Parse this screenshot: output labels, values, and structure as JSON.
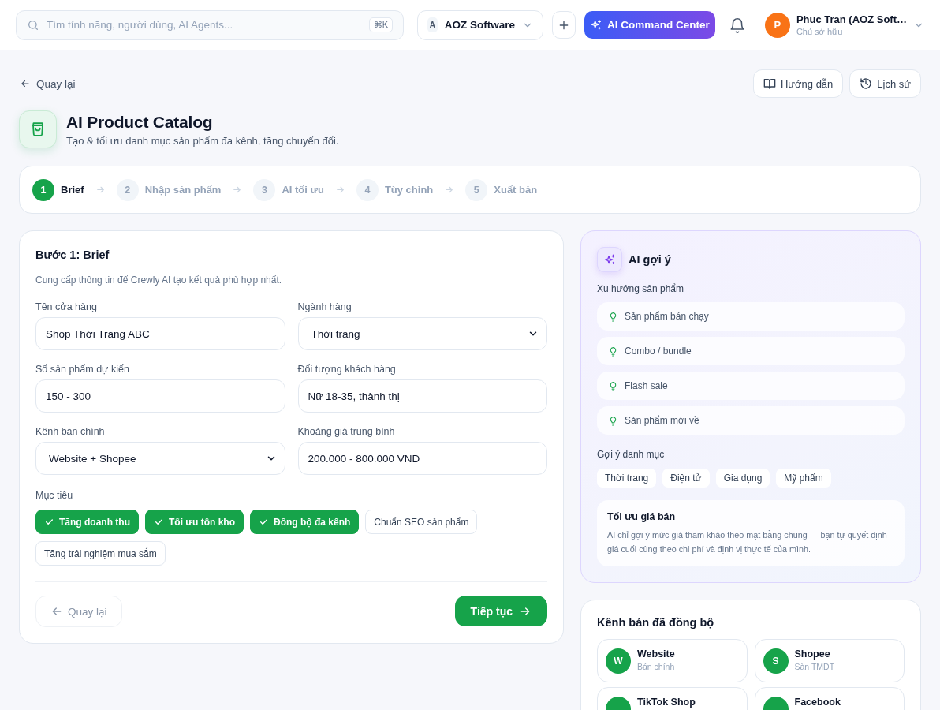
{
  "topbar": {
    "search": {
      "placeholder": "Tìm tính năng, người dùng, AI Agents...",
      "shortcut": "⌘K"
    },
    "workspace": {
      "badge": "A",
      "name": "AOZ Software"
    },
    "command_button": "AI Command Center",
    "user": {
      "initial": "P",
      "name": "Phuc Tran (AOZ Soft…",
      "role": "Chủ sở hữu"
    }
  },
  "header": {
    "back_link": "Quay lại",
    "actions": [
      {
        "kind": "guide",
        "label": "Hướng dẫn"
      },
      {
        "kind": "history",
        "label": "Lịch sử"
      }
    ],
    "title": "AI Product Catalog",
    "subtitle": "Tạo & tối ưu danh mục sản phẩm đa kênh, tăng chuyển đổi."
  },
  "steps": [
    {
      "number": "1",
      "label": "Brief",
      "selected": true
    },
    {
      "number": "2",
      "label": "Nhập sản phẩm",
      "selected": false
    },
    {
      "number": "3",
      "label": "AI tối ưu",
      "selected": false
    },
    {
      "number": "4",
      "label": "Tùy chỉnh",
      "selected": false
    },
    {
      "number": "5",
      "label": "Xuất bản",
      "selected": false
    }
  ],
  "brief_form": {
    "title": "Bước 1: Brief",
    "description": "Cung cấp thông tin để Crewly AI tạo kết quả phù hợp nhất.",
    "fields": [
      {
        "kind": "text",
        "label": "Tên cửa hàng",
        "value": "Shop Thời Trang ABC"
      },
      {
        "kind": "select",
        "label": "Ngành hàng",
        "value": "Thời trang"
      },
      {
        "kind": "text",
        "label": "Số sản phẩm dự kiến",
        "value": "150 - 300"
      },
      {
        "kind": "text",
        "label": "Đối tượng khách hàng",
        "value": "Nữ 18-35, thành thị"
      },
      {
        "kind": "select",
        "label": "Kênh bán chính",
        "value": "Website + Shopee"
      },
      {
        "kind": "text",
        "label": "Khoảng giá trung bình",
        "value": "200.000 - 800.000 VND"
      }
    ],
    "goals_label": "Mục tiêu",
    "goals": [
      {
        "label": "Tăng doanh thu",
        "selected": true
      },
      {
        "label": "Tối ưu tồn kho",
        "selected": true
      },
      {
        "label": "Đồng bộ đa kênh",
        "selected": true
      },
      {
        "label": "Chuẩn SEO sản phẩm",
        "selected": false
      },
      {
        "label": "Tăng trải nghiệm mua sắm",
        "selected": false
      }
    ],
    "back_button": {
      "label": "Quay lại",
      "disabled": true
    },
    "next_button": "Tiếp tục"
  },
  "ai_suggestions": {
    "title": "AI gợi ý",
    "trends_label": "Xu hướng sản phẩm",
    "trends": [
      "Sản phẩm bán chạy",
      "Combo / bundle",
      "Flash sale",
      "Sản phẩm mới về"
    ],
    "categories_label": "Gợi ý danh mục",
    "categories": [
      "Thời trang",
      "Điện tử",
      "Gia dụng",
      "Mỹ phẩm"
    ],
    "price_tip": {
      "title": "Tối ưu giá bán",
      "text": "AI chỉ gợi ý mức giá tham khảo theo mặt bằng chung — bạn tự quyết định giá cuối cùng theo chi phí và định vị thực tế của mình."
    }
  },
  "synced_channels": {
    "title": "Kênh bán đã đồng bộ",
    "channels": [
      {
        "initial": "W",
        "name": "Website",
        "note": "Bán chính"
      },
      {
        "initial": "S",
        "name": "Shopee",
        "note": "Sàn TMĐT"
      },
      {
        "name": "TikTok Shop"
      },
      {
        "name": "Facebook"
      }
    ]
  }
}
